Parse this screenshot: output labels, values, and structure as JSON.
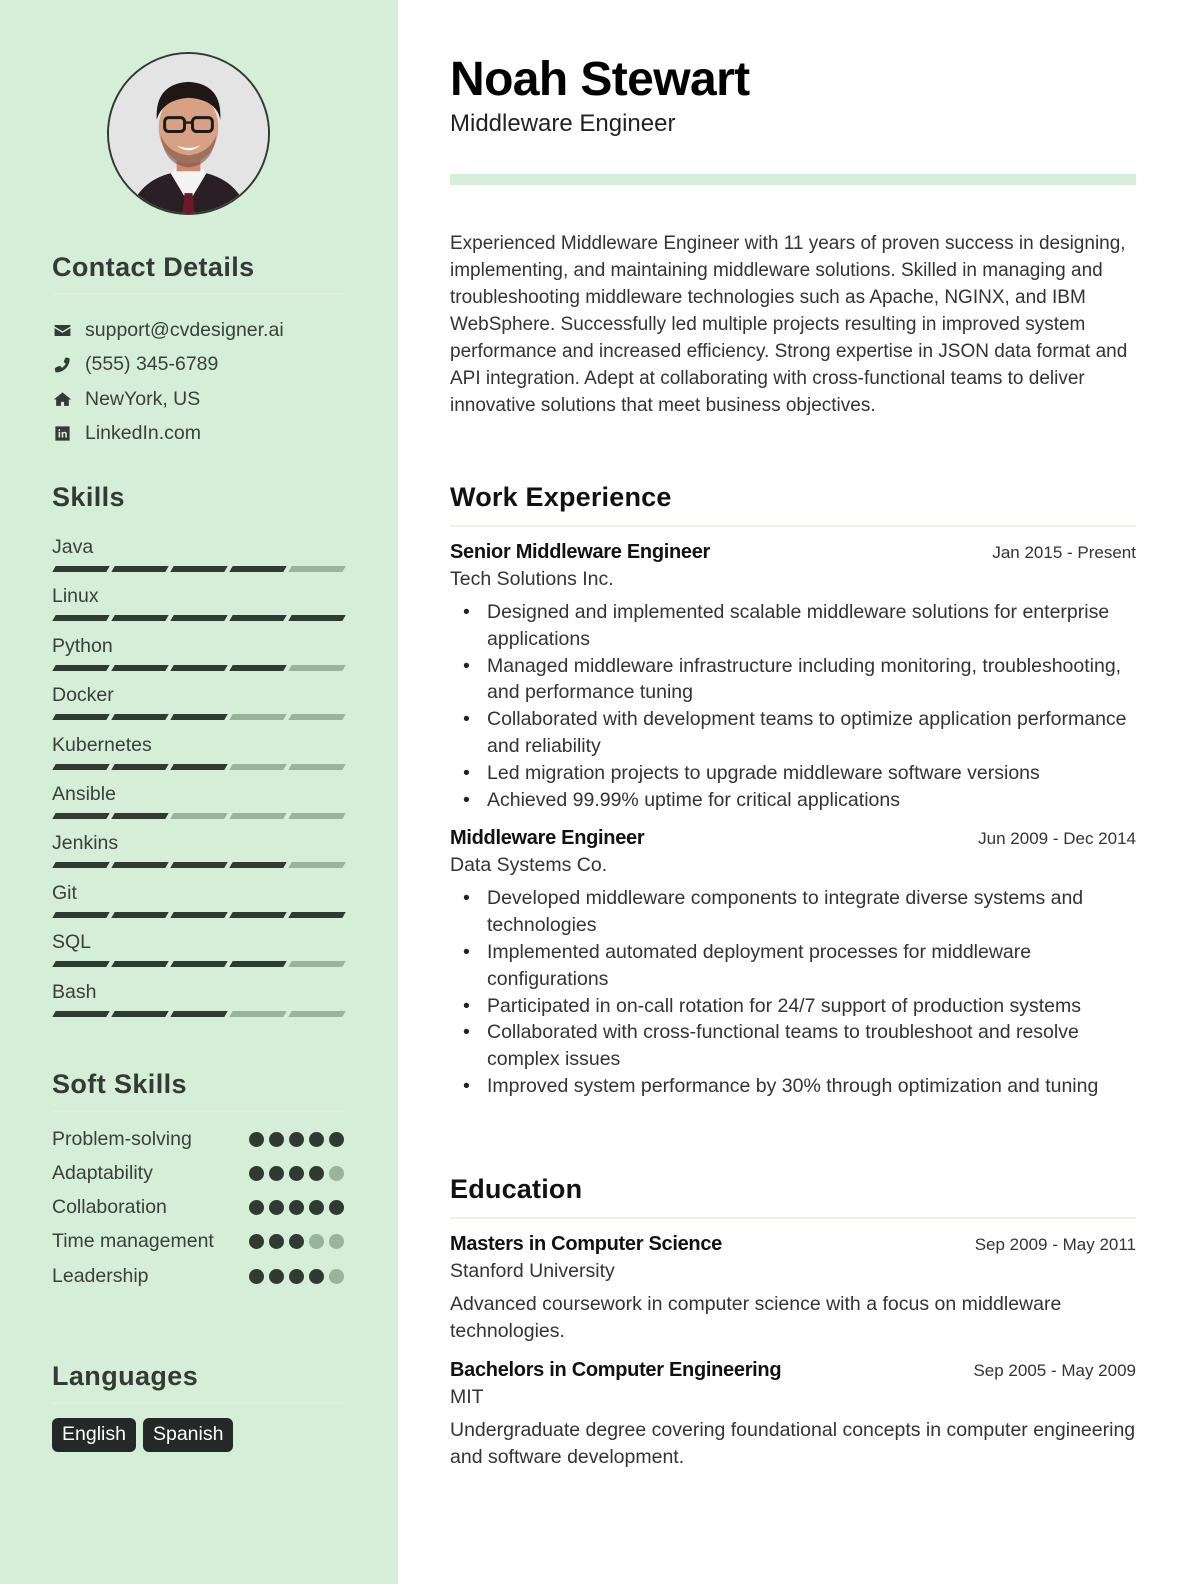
{
  "colors": {
    "sidebar_bg": "#d4eed8",
    "accent_dark": "#2f3a32",
    "accent_light": "#98b59c",
    "pill_bg": "#242826"
  },
  "profile": {
    "name": "Noah Stewart",
    "title": "Middleware Engineer",
    "photo_alt": "Profile photo",
    "summary": "Experienced Middleware Engineer with 11 years of proven success in designing, implementing, and maintaining middleware solutions. Skilled in managing and troubleshooting middleware technologies such as Apache, NGINX, and IBM WebSphere. Successfully led multiple projects resulting in improved system performance and increased efficiency. Strong expertise in JSON data format and API integration. Adept at collaborating with cross-functional teams to deliver innovative solutions that meet business objectives."
  },
  "contact": {
    "heading": "Contact Details",
    "items": [
      {
        "icon": "envelope-icon",
        "text": "support@cvdesigner.ai"
      },
      {
        "icon": "phone-icon",
        "text": "(555) 345-6789"
      },
      {
        "icon": "home-icon",
        "text": "NewYork, US"
      },
      {
        "icon": "linkedin-icon",
        "text": "LinkedIn.com"
      }
    ]
  },
  "skills": {
    "heading": "Skills",
    "max": 5,
    "items": [
      {
        "name": "Java",
        "level": 4
      },
      {
        "name": "Linux",
        "level": 5
      },
      {
        "name": "Python",
        "level": 4
      },
      {
        "name": "Docker",
        "level": 3
      },
      {
        "name": "Kubernetes",
        "level": 3
      },
      {
        "name": "Ansible",
        "level": 2
      },
      {
        "name": "Jenkins",
        "level": 4
      },
      {
        "name": "Git",
        "level": 5
      },
      {
        "name": "SQL",
        "level": 4
      },
      {
        "name": "Bash",
        "level": 3
      }
    ]
  },
  "soft_skills": {
    "heading": "Soft Skills",
    "max": 5,
    "items": [
      {
        "name": "Problem-solving",
        "level": 5
      },
      {
        "name": "Adaptability",
        "level": 4
      },
      {
        "name": "Collaboration",
        "level": 5
      },
      {
        "name": "Time management",
        "level": 3
      },
      {
        "name": "Leadership",
        "level": 4
      }
    ]
  },
  "languages": {
    "heading": "Languages",
    "items": [
      "English",
      "Spanish"
    ]
  },
  "work": {
    "heading": "Work Experience",
    "items": [
      {
        "title": "Senior Middleware Engineer",
        "company": "Tech Solutions Inc.",
        "dates": "Jan 2015 - Present",
        "bullets": [
          "Designed and implemented scalable middleware solutions for enterprise applications",
          "Managed middleware infrastructure including monitoring, troubleshooting, and performance tuning",
          "Collaborated with development teams to optimize application performance and reliability",
          "Led migration projects to upgrade middleware software versions",
          "Achieved 99.99% uptime for critical applications"
        ]
      },
      {
        "title": "Middleware Engineer",
        "company": "Data Systems Co.",
        "dates": "Jun 2009 - Dec 2014",
        "bullets": [
          "Developed middleware components to integrate diverse systems and technologies",
          "Implemented automated deployment processes for middleware configurations",
          "Participated in on-call rotation for 24/7 support of production systems",
          "Collaborated with cross-functional teams to troubleshoot and resolve complex issues",
          "Improved system performance by 30% through optimization and tuning"
        ]
      }
    ]
  },
  "education": {
    "heading": "Education",
    "items": [
      {
        "degree": "Masters in Computer Science",
        "school": "Stanford University",
        "dates": "Sep 2009 - May 2011",
        "description": "Advanced coursework in computer science with a focus on middleware technologies."
      },
      {
        "degree": "Bachelors in Computer Engineering",
        "school": "MIT",
        "dates": "Sep 2005 - May 2009",
        "description": "Undergraduate degree covering foundational concepts in computer engineering and software development."
      }
    ]
  }
}
